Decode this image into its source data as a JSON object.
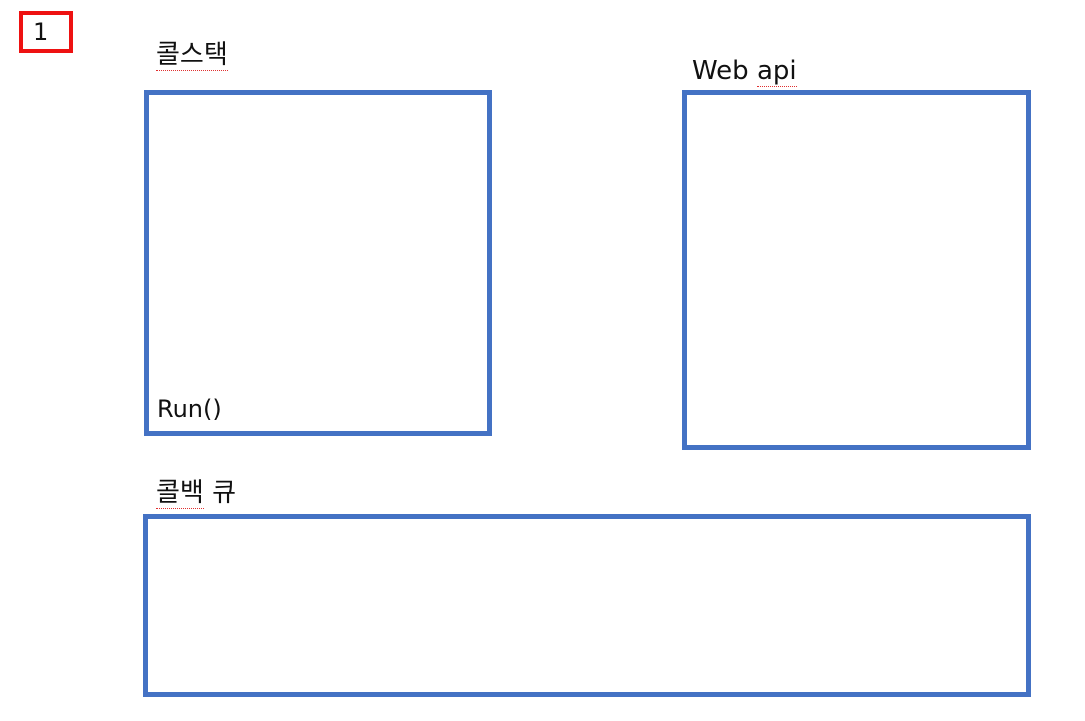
{
  "step": "1",
  "call_stack": {
    "label": "콜스택",
    "items": [
      "Run()"
    ]
  },
  "web_api": {
    "label_word1": "Web",
    "label_word2": "api"
  },
  "callback_queue": {
    "label_word1": "콜백",
    "label_word2": "큐"
  },
  "colors": {
    "box_border": "#4472c4",
    "badge_border": "#ee1111"
  }
}
